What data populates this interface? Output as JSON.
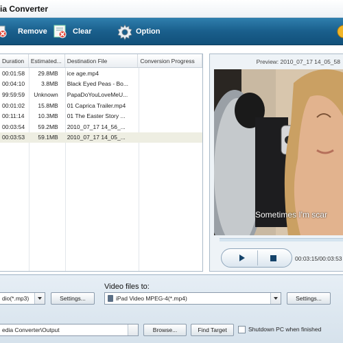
{
  "window": {
    "title": "ia Converter"
  },
  "toolbar": {
    "remove_label": "Remove",
    "clear_label": "Clear",
    "option_label": "Option",
    "icons": [
      "remove-icon",
      "clear-icon",
      "gear-icon",
      "help-icon"
    ]
  },
  "list": {
    "headers": [
      "Duration",
      "Estimated...",
      "Destination File",
      "Conversion Progress"
    ],
    "rows": [
      {
        "duration": "00:01:58",
        "size": "29.8MB",
        "dest": "ice age.mp4",
        "progress": ""
      },
      {
        "duration": "00:04:10",
        "size": "3.8MB",
        "dest": "Black Eyed Peas - Bo...",
        "progress": ""
      },
      {
        "duration": "99:59:59",
        "size": "Unknown",
        "dest": "PapaDoYouLoveMeU...",
        "progress": ""
      },
      {
        "duration": "00:01:02",
        "size": "15.8MB",
        "dest": "01 Caprica Trailer.mp4",
        "progress": ""
      },
      {
        "duration": "00:11:14",
        "size": "10.3MB",
        "dest": "01 The Easter Story ...",
        "progress": ""
      },
      {
        "duration": "00:03:54",
        "size": "59.2MB",
        "dest": "2010_07_17 14_56_...",
        "progress": ""
      },
      {
        "duration": "00:03:53",
        "size": "59.1MB",
        "dest": "2010_07_17 14_05_...",
        "progress": ""
      }
    ]
  },
  "preview": {
    "label": "Preview:  2010_07_17 14_05_58",
    "subtitle": "Sometimes I'm scar",
    "time": "00:03:15/00:03:53",
    "play_icon": "play-icon",
    "stop_icon": "stop-icon"
  },
  "output": {
    "audio_format": "dio(*.mp3)",
    "audio_settings": "Settings...",
    "video_files_to_label": "Video files to:",
    "video_format": "iPad Video MPEG-4(*.mp4)",
    "video_settings": "Settings...",
    "output_folder": "edia Converter\\Output",
    "browse": "Browse...",
    "find_target": "Find Target",
    "shutdown_label": "Shutdown PC when finished",
    "shutdown_checked": false
  }
}
